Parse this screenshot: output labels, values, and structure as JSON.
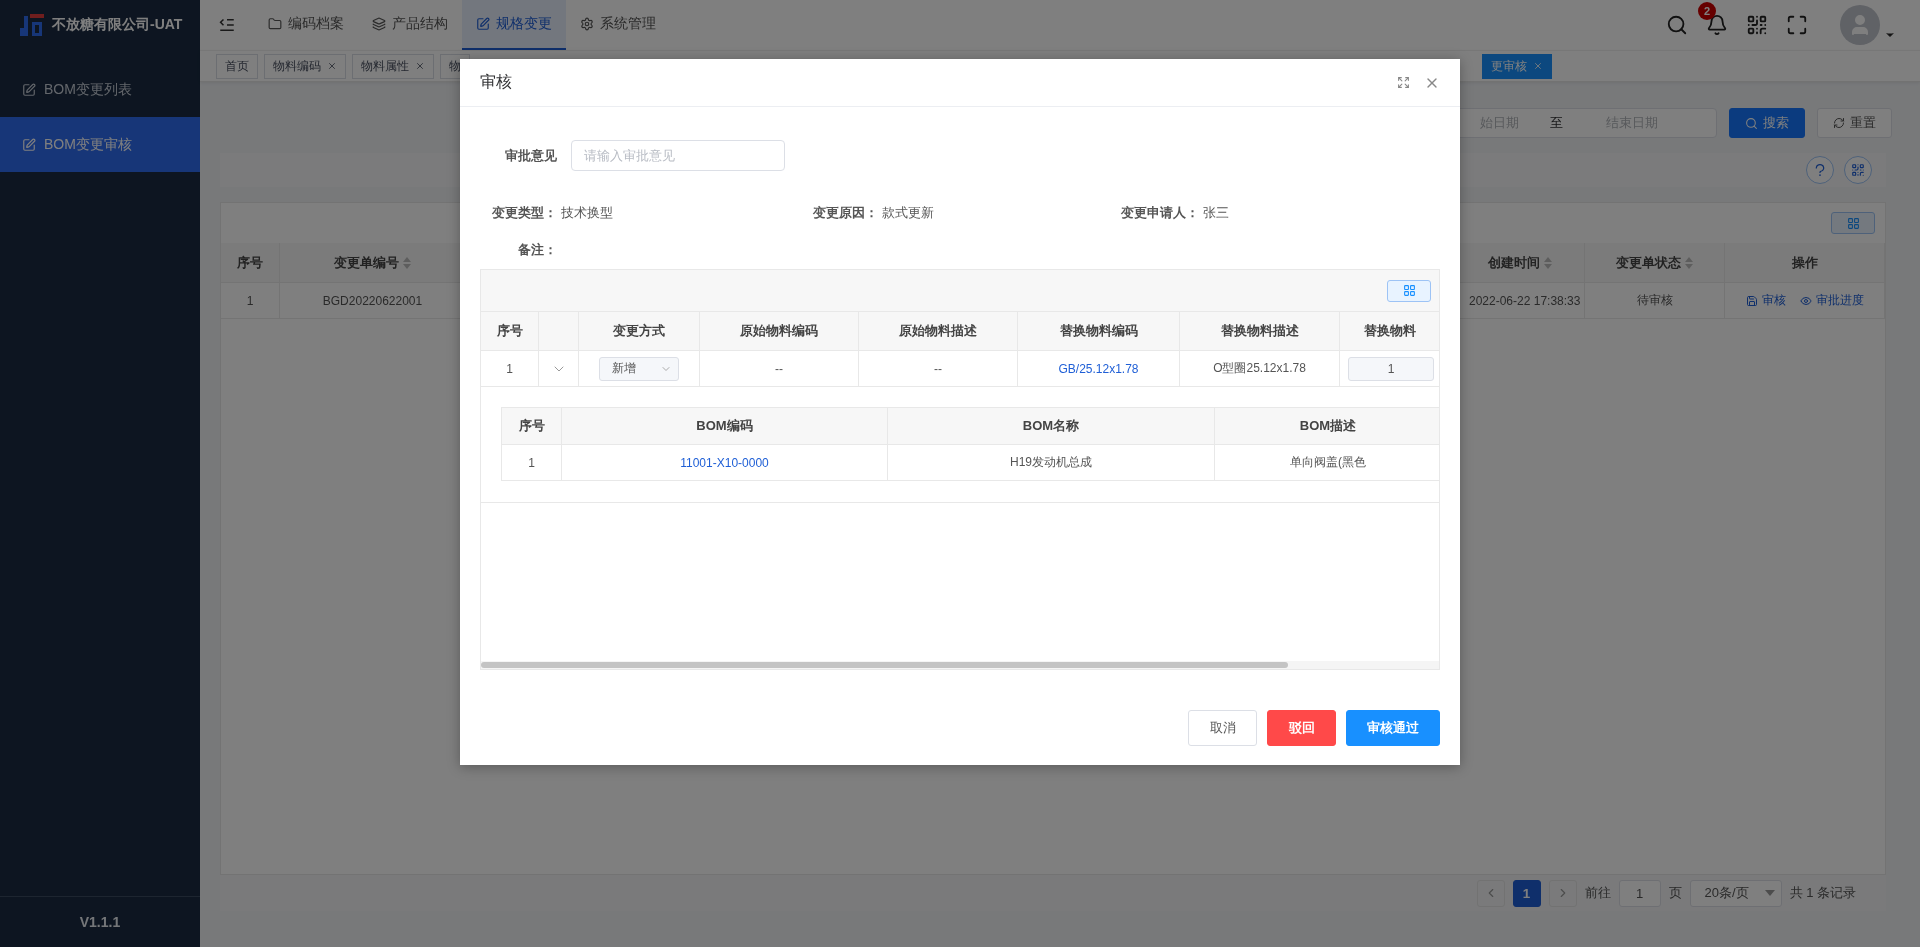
{
  "app": {
    "company": "不放糖有限公司-UAT",
    "version": "V1.1.1"
  },
  "sidebar": {
    "items": [
      {
        "label": "BOM变更列表",
        "selected": false
      },
      {
        "label": "BOM变更审核",
        "selected": true
      }
    ]
  },
  "top_nav": {
    "items": [
      {
        "label": "编码档案",
        "selected": false
      },
      {
        "label": "产品结构",
        "selected": false
      },
      {
        "label": "规格变更",
        "selected": true
      },
      {
        "label": "系统管理",
        "selected": false
      }
    ]
  },
  "notifications": {
    "count": "2"
  },
  "page_tabs": [
    {
      "label": "首页",
      "closable": false,
      "selected": false
    },
    {
      "label": "物料编码",
      "closable": true,
      "selected": false
    },
    {
      "label": "物料属性",
      "closable": true,
      "selected": false
    },
    {
      "label": "物",
      "closable": false,
      "selected": false
    },
    {
      "label": "更审核",
      "closable": true,
      "selected": true
    }
  ],
  "search": {
    "date_start": "始日期",
    "date_separator": "至",
    "date_end": "结束日期",
    "search_button": "搜索",
    "reset_button": "重置"
  },
  "table": {
    "columns": [
      {
        "label": "序号",
        "sortable": false
      },
      {
        "label": "变更单编号",
        "sortable": true
      },
      {
        "label": "创建时间",
        "sortable": true
      },
      {
        "label": "变更单状态",
        "sortable": true
      },
      {
        "label": "操作",
        "sortable": false
      }
    ],
    "rows": [
      {
        "cells": [
          "1",
          "BGD20220622001",
          "2022-06-22 17:38:33",
          "待审核"
        ],
        "actions": [
          "审核",
          "审批进度"
        ]
      }
    ]
  },
  "pagination": {
    "pages": [
      {
        "label": "1",
        "selected": true
      }
    ],
    "goto_label": "前往",
    "goto_value": "1",
    "page_unit": "页",
    "page_size": "20条/页",
    "total": "共 1 条记录"
  },
  "dialog": {
    "title": "审核",
    "opinion": {
      "label": "审批意见",
      "placeholder": "请输入审批意见"
    },
    "info": [
      {
        "label": "变更类型：",
        "value": "技术换型"
      },
      {
        "label": "变更原因：",
        "value": "款式更新"
      },
      {
        "label": "变更申请人：",
        "value": "张三"
      }
    ],
    "remark": {
      "label": "备注："
    },
    "detail_table": {
      "columns": [
        "序号",
        "变更方式",
        "原始物料编码",
        "原始物料描述",
        "替换物料编码",
        "替换物料描述",
        "替换物料"
      ],
      "rows": [
        {
          "index": "1",
          "expanded": true,
          "change_mode": "新增",
          "original_code": "--",
          "original_desc": "--",
          "new_code": "GB/25.12x1.78",
          "new_desc": "O型圈25.12x1.78",
          "quantity": "1",
          "bom_table": {
            "columns": [
              "序号",
              "BOM编码",
              "BOM名称",
              "BOM描述"
            ],
            "rows": [
              {
                "cells": [
                  "1",
                  "11001-X10-0000",
                  "H19发动机总成",
                  "单向阀盖(黑色"
                ]
              }
            ]
          }
        }
      ]
    },
    "buttons": [
      {
        "label": "取消",
        "kind": "default"
      },
      {
        "label": "驳回",
        "kind": "danger"
      },
      {
        "label": "审核通过",
        "kind": "primary"
      }
    ]
  }
}
